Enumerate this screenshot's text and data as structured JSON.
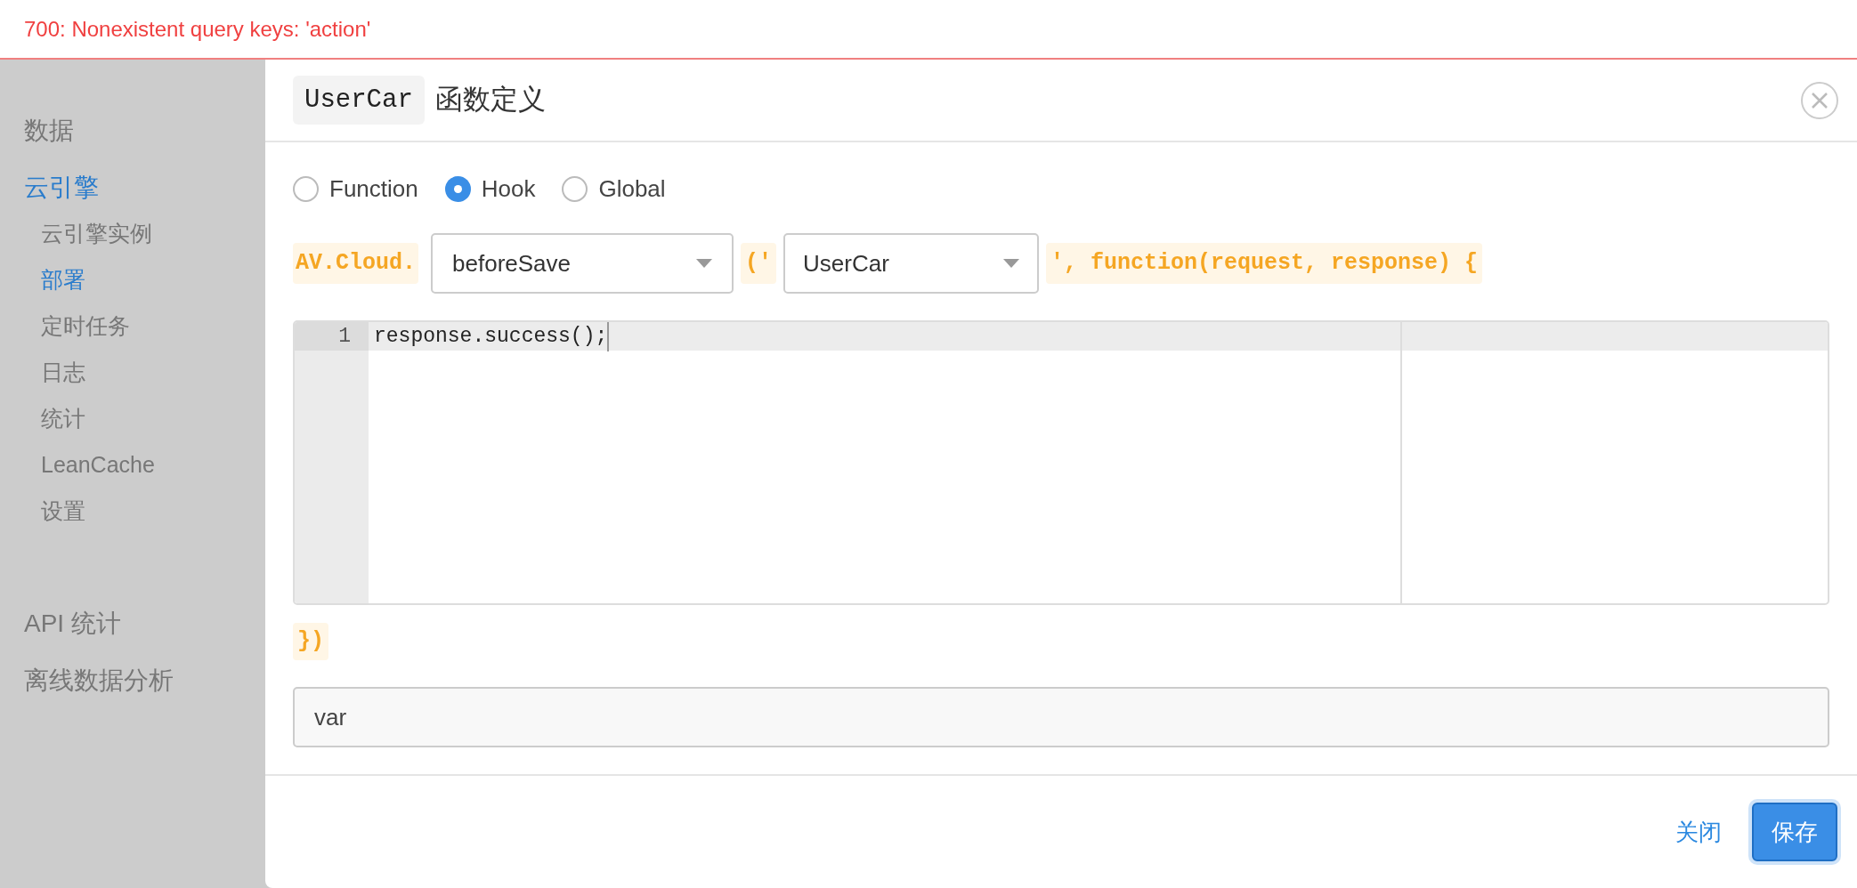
{
  "error_banner": {
    "text": "700: Nonexistent query keys: 'action'"
  },
  "sidebar": {
    "items": [
      {
        "label": "数据",
        "selected": false
      },
      {
        "label": "云引擎",
        "selected": true,
        "children": [
          {
            "label": "云引擎实例",
            "selected": false
          },
          {
            "label": "部署",
            "selected": true
          },
          {
            "label": "定时任务",
            "selected": false
          },
          {
            "label": "日志",
            "selected": false
          },
          {
            "label": "统计",
            "selected": false
          },
          {
            "label": "LeanCache",
            "selected": false
          },
          {
            "label": "设置",
            "selected": false
          }
        ]
      },
      {
        "label": "API 统计",
        "selected": false
      },
      {
        "label": "离线数据分析",
        "selected": false
      }
    ]
  },
  "dialog": {
    "title_code": "UserCar",
    "title": "函数定义",
    "types": [
      {
        "label": "Function",
        "selected": false
      },
      {
        "label": "Hook",
        "selected": true
      },
      {
        "label": "Global",
        "selected": false
      }
    ],
    "prefix": "AV.Cloud.",
    "hook_select": "beforeSave",
    "open_paren": "('",
    "class_select": "UserCar",
    "suffix": "', function(request, response) {",
    "editor": {
      "lines": [
        {
          "number": "1",
          "code": "response.success();"
        }
      ]
    },
    "closing": "})",
    "var_field": {
      "value": "var"
    },
    "buttons": [
      {
        "label": "关闭",
        "kind": "link"
      },
      {
        "label": "保存",
        "kind": "primary"
      }
    ]
  }
}
